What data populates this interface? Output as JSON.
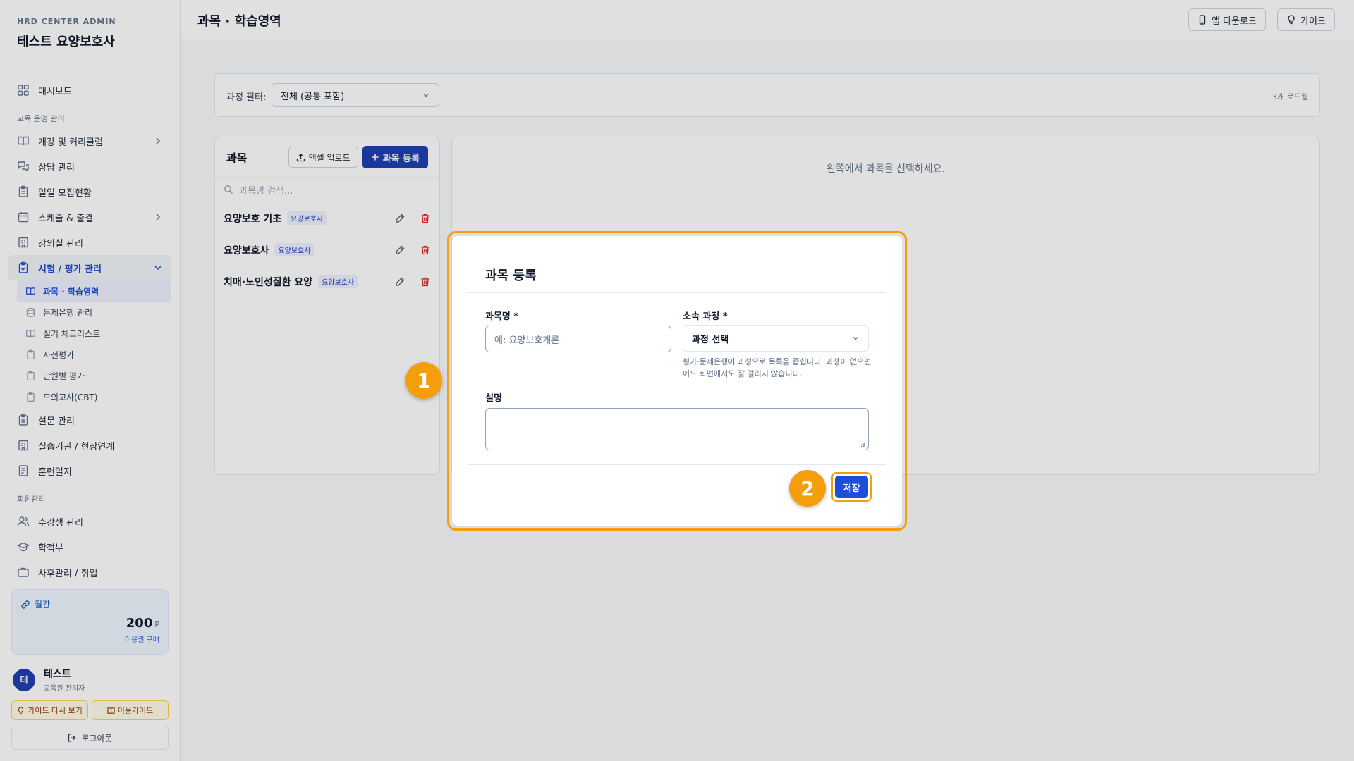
{
  "brand": {
    "sub": "HRD CENTER ADMIN",
    "title": "테스트 요양보호사"
  },
  "nav": {
    "dashboard": "대시보드",
    "section_edu": "교육 운영 관리",
    "curriculum": "개강 및 커리큘럼",
    "consult": "상담 관리",
    "daily_recruit": "일일 모집현황",
    "schedule": "스케줄 & 출결",
    "classroom": "강의실 관리",
    "exam": "시험 / 평가 관리",
    "exam_sub": [
      "과목 · 학습영역",
      "문제은행 관리",
      "실기 체크리스트",
      "사전평가",
      "단원별 평가",
      "모의고사(CBT)"
    ],
    "survey": "설문 관리",
    "practice": "실습기관 / 현장연계",
    "training_log": "훈련일지",
    "section_member": "회원관리",
    "students": "수강생 관리",
    "registry": "학적부",
    "aftercare": "사후관리 / 취업"
  },
  "points": {
    "label": "월간",
    "value": "200",
    "unit": "P",
    "buy": "이용권 구매"
  },
  "profile": {
    "initial": "테",
    "name": "테스트",
    "role": "교육원 관리자"
  },
  "footer": {
    "guide_again": "가이드 다시 보기",
    "usage_guide": "이용가이드",
    "logout": "로그아웃"
  },
  "topbar": {
    "title": "과목 · 학습영역",
    "app_download": "앱 다운로드",
    "guide": "가이드"
  },
  "filter": {
    "label": "과정 필터:",
    "value": "전체 (공통 포함)",
    "count": "3개 로드됨"
  },
  "subjects_panel": {
    "title": "과목",
    "excel_upload": "엑셀 업로드",
    "add": "과목 등록",
    "search_placeholder": "과목명 검색...",
    "items": [
      {
        "name": "요양보호 기초",
        "tag": "요양보호사"
      },
      {
        "name": "요양보호사",
        "tag": "요양보호사"
      },
      {
        "name": "치매·노인성질환 요양",
        "tag": "요양보호사"
      }
    ]
  },
  "detail": {
    "empty": "왼쪽에서 과목을 선택하세요."
  },
  "modal": {
    "title": "과목 등록",
    "name_label": "과목명 *",
    "name_placeholder": "예: 요양보호개론",
    "course_label": "소속 과정 *",
    "course_value": "과정 선택",
    "help": "평가·문제은행이 과정으로 목록을 좁힙니다. 과정이 없으면 어느 화면에서도 잘 걸리지 않습니다.",
    "desc_label": "설명",
    "save": "저장"
  },
  "steps": [
    "1",
    "2"
  ],
  "colors": {
    "accent": "#1e40af",
    "highlight": "#f59e0b",
    "danger": "#dc2626"
  }
}
